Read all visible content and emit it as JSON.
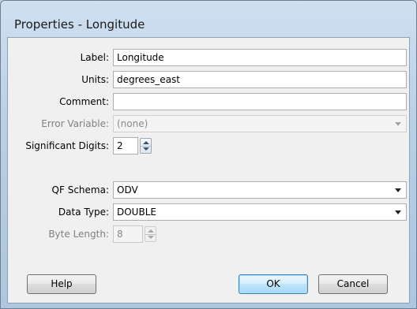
{
  "window": {
    "title": "Properties - Longitude"
  },
  "form": {
    "label": {
      "caption": "Label:",
      "value": "Longitude"
    },
    "units": {
      "caption": "Units:",
      "value": "degrees_east"
    },
    "comment": {
      "caption": "Comment:",
      "value": ""
    },
    "error_variable": {
      "caption": "Error Variable:",
      "value": "(none)"
    },
    "significant_digits": {
      "caption": "Significant Digits:",
      "value": "2"
    },
    "qf_schema": {
      "caption": "QF Schema:",
      "value": "ODV"
    },
    "data_type": {
      "caption": "Data Type:",
      "value": "DOUBLE"
    },
    "byte_length": {
      "caption": "Byte Length:",
      "value": "8"
    }
  },
  "buttons": {
    "help": "Help",
    "ok": "OK",
    "cancel": "Cancel"
  },
  "icons": [
    "chevron-down-icon",
    "spin-up-icon",
    "spin-down-icon"
  ]
}
